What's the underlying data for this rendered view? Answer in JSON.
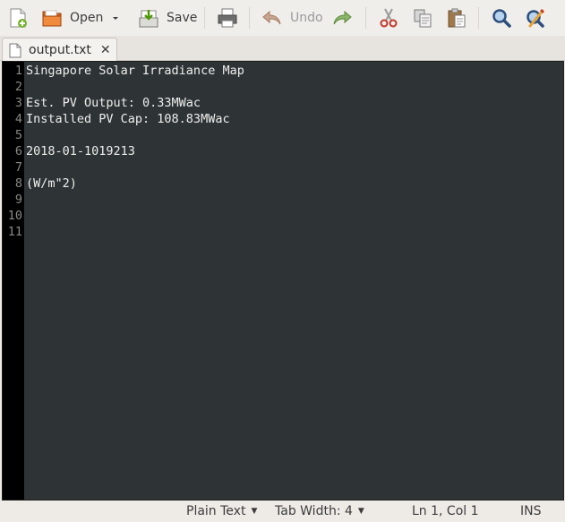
{
  "toolbar": {
    "open_label": "Open",
    "save_label": "Save",
    "undo_label": "Undo"
  },
  "tab": {
    "filename": "output.txt",
    "close_glyph": "✕"
  },
  "editor": {
    "line_numbers": [
      "1",
      "2",
      "3",
      "4",
      "5",
      "6",
      "7",
      "8",
      "9",
      "10",
      "11"
    ],
    "lines": [
      "Singapore Solar Irradiance Map",
      "",
      "Est. PV Output: 0.33MWac",
      "Installed PV Cap: 108.83MWac",
      "",
      "2018-01-1019213",
      "",
      "(W/m\"2)",
      "",
      "",
      ""
    ]
  },
  "statusbar": {
    "language": "Plain Text",
    "tab_width": "Tab Width: 4",
    "cursor_position": "Ln 1, Col 1",
    "insert_mode": "INS"
  },
  "icons": {
    "new": "new-document-icon",
    "open": "open-folder-icon",
    "open_dropdown": "chevron-down-icon",
    "save": "save-icon",
    "print": "print-icon",
    "undo": "undo-icon",
    "redo": "redo-icon",
    "cut": "cut-icon",
    "copy": "copy-icon",
    "paste": "paste-icon",
    "find": "search-icon",
    "replace": "find-replace-icon"
  },
  "colors": {
    "editor_background": "#2e3436",
    "gutter_background": "#000000",
    "text": "#eeeeec",
    "line_number": "#888a85"
  }
}
